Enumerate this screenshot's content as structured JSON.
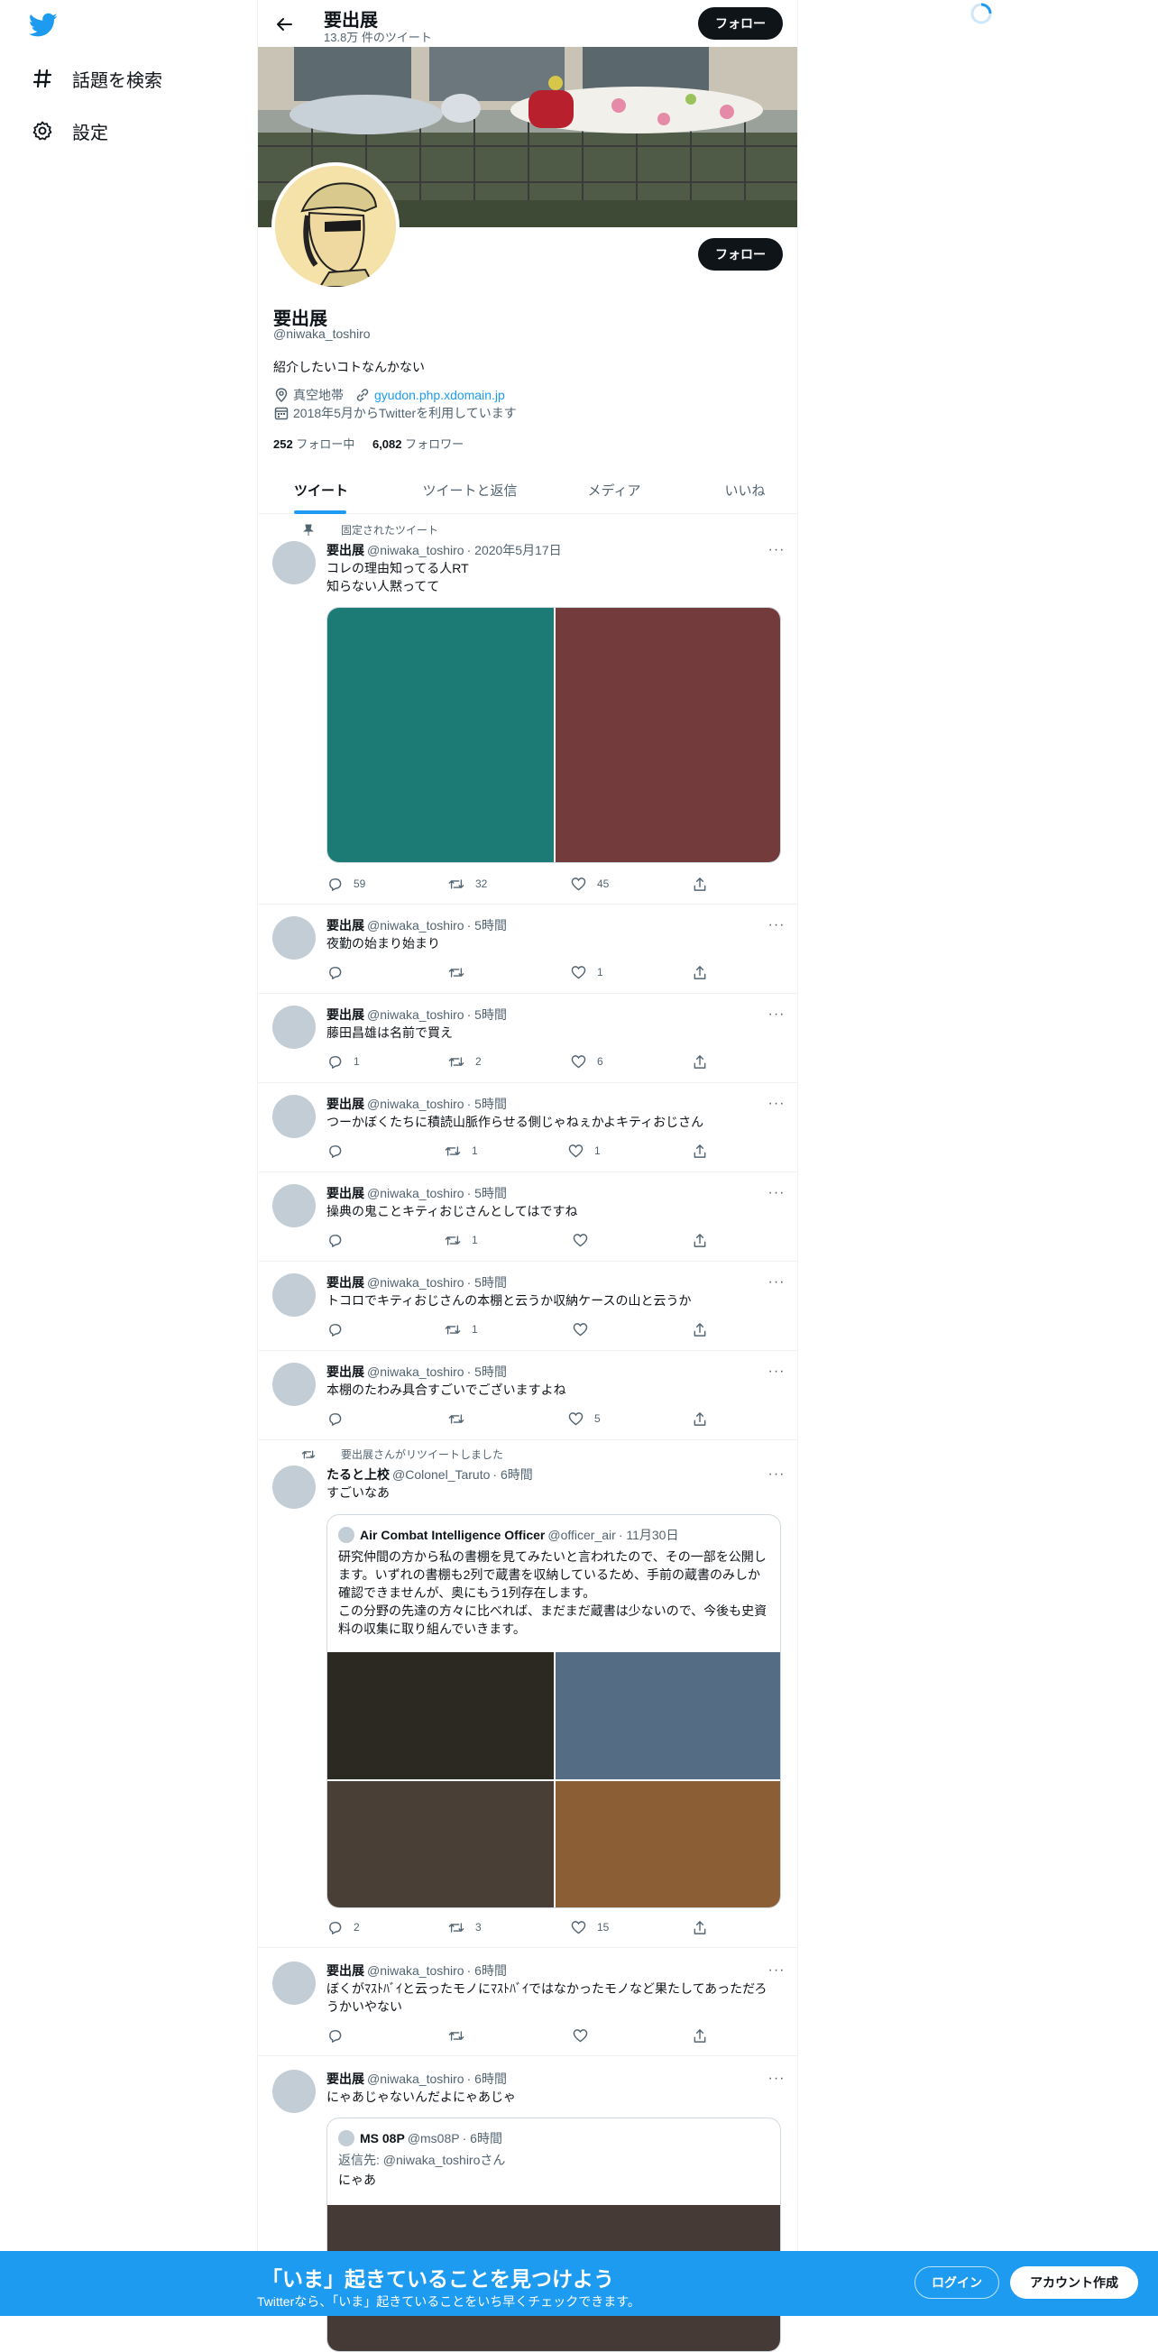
{
  "sidebar": {
    "logo_icon": "twitter-bird-icon",
    "items": [
      {
        "icon": "hashtag-icon",
        "label": "話題を検索"
      },
      {
        "icon": "gear-icon",
        "label": "設定"
      }
    ]
  },
  "header": {
    "name": "要出展",
    "tweet_count": "13.8万 件のツイート",
    "follow_label": "フォロー"
  },
  "profile": {
    "name": "要出展",
    "handle": "@niwaka_toshiro",
    "bio": "紹介したいコトなんかない",
    "location": "真空地帯",
    "url": "gyudon.php.xdomain.jp",
    "joined": "2018年5月からTwitterを利用しています",
    "following_count": "252",
    "following_label": "フォロー中",
    "followers_count": "6,082",
    "followers_label": "フォロワー",
    "follow_label": "フォロー"
  },
  "tabs": [
    "ツイート",
    "ツイートと返信",
    "メディア",
    "いいね"
  ],
  "tweets": [
    {
      "context": "固定されたツイート",
      "name": "要出展",
      "handle": "@niwaka_toshiro",
      "time": "· 2020年5月17日",
      "text": "コレの理由知ってる人RT\n知らない人黙ってて",
      "reply": "59",
      "retweet": "32",
      "like": "45"
    },
    {
      "name": "要出展",
      "handle": "@niwaka_toshiro",
      "time": "· 5時間",
      "text": "夜勤の始まり始まり",
      "reply": "",
      "retweet": "",
      "like": "1"
    },
    {
      "name": "要出展",
      "handle": "@niwaka_toshiro",
      "time": "· 5時間",
      "text": "藤田昌雄は名前で買え",
      "reply": "1",
      "retweet": "2",
      "like": "6"
    },
    {
      "name": "要出展",
      "handle": "@niwaka_toshiro",
      "time": "· 5時間",
      "text": "つーかぼくたちに積読山脈作らせる側じゃねぇかよキティおじさん",
      "reply": "",
      "retweet": "1",
      "like": "1"
    },
    {
      "name": "要出展",
      "handle": "@niwaka_toshiro",
      "time": "· 5時間",
      "text": "操典の鬼ことキティおじさんとしてはですね",
      "reply": "",
      "retweet": "1",
      "like": ""
    },
    {
      "name": "要出展",
      "handle": "@niwaka_toshiro",
      "time": "· 5時間",
      "text": "トコロでキティおじさんの本棚と云うか収納ケースの山と云うか",
      "reply": "",
      "retweet": "1",
      "like": ""
    },
    {
      "name": "要出展",
      "handle": "@niwaka_toshiro",
      "time": "· 5時間",
      "text": "本棚のたわみ具合すごいでございますよね",
      "reply": "",
      "retweet": "",
      "like": "5"
    },
    {
      "context": "要出展さんがリツイートしました",
      "name": "たると上校",
      "handle": "@Colonel_Taruto",
      "time": "· 6時間",
      "text": "すごいなあ",
      "quote": {
        "name": "Air Combat Intelligence Officer",
        "handle": "@officer_air",
        "time": "· 11月30日",
        "text": "研究仲間の方から私の書棚を見てみたいと言われたので、その一部を公開します。いずれの書棚も2列で蔵書を収納しているため、手前の蔵書のみしか確認できませんが、奥にもう1列存在します。\nこの分野の先達の方々に比べれば、まだまだ蔵書は少ないので、今後も史資料の収集に取り組んでいきます。"
      },
      "reply": "2",
      "retweet": "3",
      "like": "15"
    },
    {
      "name": "要出展",
      "handle": "@niwaka_toshiro",
      "time": "· 6時間",
      "text": "ぼくがﾏｽﾄﾊﾞｲと云ったモノにﾏｽﾄﾊﾞｲではなかったモノなど果たしてあっただろうかいやない",
      "reply": "",
      "retweet": "",
      "like": ""
    },
    {
      "name": "要出展",
      "handle": "@niwaka_toshiro",
      "time": "· 6時間",
      "text": "にゃあじゃないんだよにゃあじゃ",
      "quote": {
        "name": "MS 08P",
        "handle": "@ms08P",
        "time": "· 6時間",
        "reply_to": "返信先: @niwaka_toshiroさん",
        "text": "にゃあ"
      }
    }
  ],
  "bottom_bar": {
    "title": "「いま」起きていることを見つけよう",
    "subtitle": "Twitterなら、「いま」起きていることをいち早くチェックできます。",
    "login": "ログイン",
    "signup": "アカウント作成"
  },
  "colors": {
    "accent": "#1d9bf0",
    "text": "#0f1419",
    "muted": "#536471"
  }
}
